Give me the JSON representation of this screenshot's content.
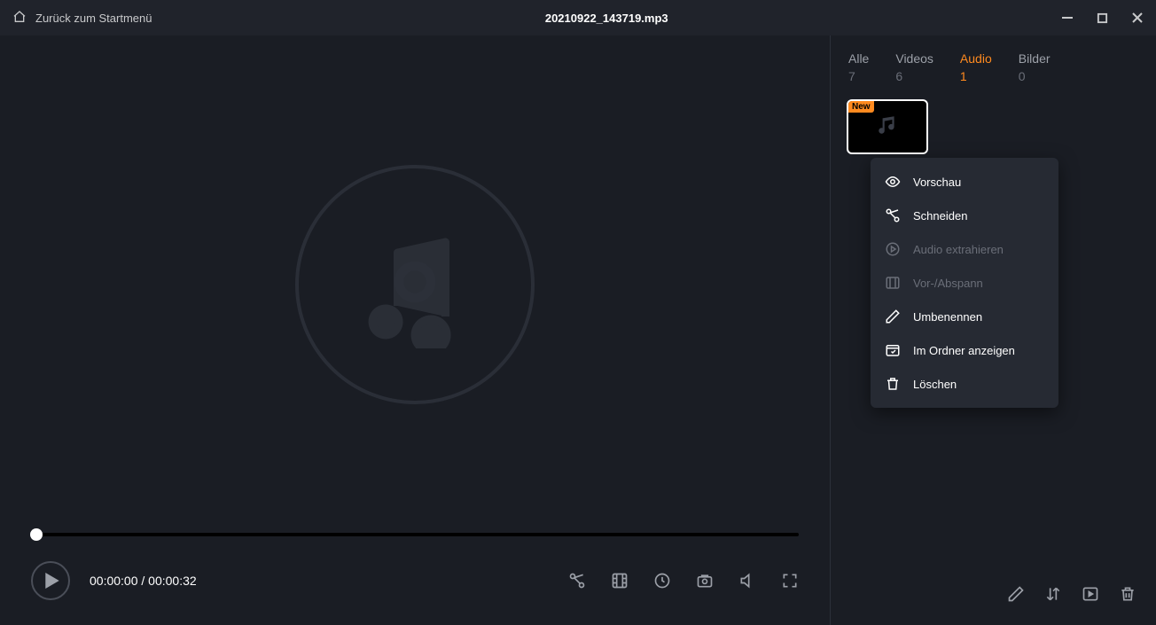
{
  "titlebar": {
    "back_label": "Zurück zum Startmenü",
    "filename": "20210922_143719.mp3"
  },
  "player": {
    "current_time": "00:00:00",
    "sep": " / ",
    "duration": "00:00:32"
  },
  "sidebar": {
    "tabs": [
      {
        "label": "Alle",
        "count": "7"
      },
      {
        "label": "Videos",
        "count": "6"
      },
      {
        "label": "Audio",
        "count": "1"
      },
      {
        "label": "Bilder",
        "count": "0"
      }
    ],
    "thumb_badge": "New"
  },
  "context_menu": {
    "items": [
      {
        "label": "Vorschau",
        "disabled": false
      },
      {
        "label": "Schneiden",
        "disabled": false
      },
      {
        "label": "Audio extrahieren",
        "disabled": true
      },
      {
        "label": "Vor-/Abspann",
        "disabled": true
      },
      {
        "label": "Umbenennen",
        "disabled": false
      },
      {
        "label": "Im Ordner anzeigen",
        "disabled": false
      },
      {
        "label": "Löschen",
        "disabled": false
      }
    ]
  }
}
